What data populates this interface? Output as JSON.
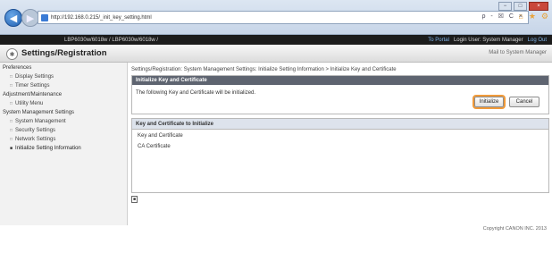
{
  "browser": {
    "url": "http://192.168.0.215/_init_key_setting.html",
    "tools": "ρ - ☒ C ×",
    "min": "−",
    "max": "□",
    "close": "×"
  },
  "header": {
    "device_name": "LBP6030w/6018w / LBP6030w/6018w /",
    "to_portal": "To Portal",
    "login_user": "Login User: System Manager",
    "logout": "Log Out"
  },
  "title": {
    "text": "Settings/Registration",
    "mail": "Mail to System Manager"
  },
  "sidebar": {
    "items": [
      {
        "label": "Preferences",
        "type": "header"
      },
      {
        "label": "Display Settings",
        "type": "sub"
      },
      {
        "label": "Timer Settings",
        "type": "sub"
      },
      {
        "label": "Adjustment/Maintenance",
        "type": "header"
      },
      {
        "label": "Utility Menu",
        "type": "sub"
      },
      {
        "label": "System Management Settings",
        "type": "header"
      },
      {
        "label": "System Management",
        "type": "sub"
      },
      {
        "label": "Security Settings",
        "type": "sub"
      },
      {
        "label": "Network Settings",
        "type": "sub"
      },
      {
        "label": "Initialize Setting Information",
        "type": "active"
      }
    ]
  },
  "main": {
    "breadcrumb": "Settings/Registration: System Management Settings: Initialize Setting Information > Initialize Key and Certificate",
    "panel1": {
      "title": "Initialize Key and Certificate",
      "message": "The following Key and Certificate will be initialized.",
      "initialize_label": "Initialize",
      "cancel_label": "Cancel"
    },
    "panel2": {
      "title": "Key and Certificate to Initialize",
      "rows": [
        "Key and Certificate",
        "CA Certificate"
      ]
    },
    "toggle_icon": "■",
    "copyright": "Copyright CANON INC. 2013"
  },
  "colors": {
    "accent_orange": "#f09a3a",
    "panel_header": "#5e6470",
    "dark_bar": "#1c1c1c"
  }
}
